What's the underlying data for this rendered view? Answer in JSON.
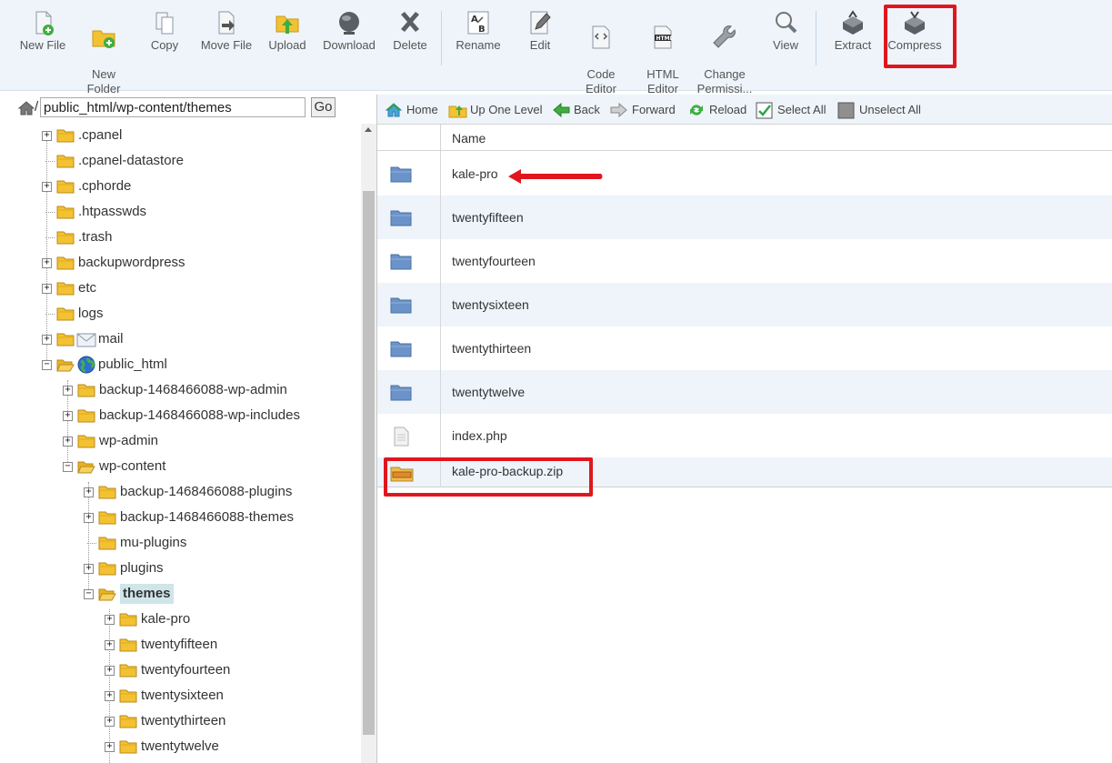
{
  "toolbar": {
    "buttons": [
      {
        "id": "new-file",
        "label": "New File"
      },
      {
        "id": "new-folder",
        "label": "New\nFolder"
      },
      {
        "id": "copy",
        "label": "Copy"
      },
      {
        "id": "move-file",
        "label": "Move File"
      },
      {
        "id": "upload",
        "label": "Upload"
      },
      {
        "id": "download",
        "label": "Download"
      },
      {
        "id": "delete",
        "label": "Delete"
      },
      {
        "id": "rename",
        "label": "Rename"
      },
      {
        "id": "edit",
        "label": "Edit"
      },
      {
        "id": "code-editor",
        "label": "Code\nEditor"
      },
      {
        "id": "html-editor",
        "label": "HTML\nEditor"
      },
      {
        "id": "change-permissions",
        "label": "Change\nPermissi..."
      },
      {
        "id": "view",
        "label": "View"
      },
      {
        "id": "extract",
        "label": "Extract"
      },
      {
        "id": "compress",
        "label": "Compress"
      }
    ],
    "html_icon_text": "HTML",
    "rename_icon_a": "A",
    "rename_icon_b": "B"
  },
  "path": {
    "root_sep": "/",
    "value": "public_html/wp-content/themes",
    "go_label": "Go"
  },
  "tree": [
    {
      "label": ".cpanel",
      "depth": 0,
      "expandable": true
    },
    {
      "label": ".cpanel-datastore",
      "depth": 0,
      "expandable": false
    },
    {
      "label": ".cphorde",
      "depth": 0,
      "expandable": true
    },
    {
      "label": ".htpasswds",
      "depth": 0,
      "expandable": false
    },
    {
      "label": ".trash",
      "depth": 0,
      "expandable": false
    },
    {
      "label": "backupwordpress",
      "depth": 0,
      "expandable": true
    },
    {
      "label": "etc",
      "depth": 0,
      "expandable": true
    },
    {
      "label": "logs",
      "depth": 0,
      "expandable": false
    },
    {
      "label": "mail",
      "depth": 0,
      "expandable": true,
      "icon": "mail"
    },
    {
      "label": "public_html",
      "depth": 0,
      "expandable": true,
      "expanded": true,
      "icon": "globe"
    },
    {
      "label": "backup-1468466088-wp-admin",
      "depth": 1,
      "expandable": true
    },
    {
      "label": "backup-1468466088-wp-includes",
      "depth": 1,
      "expandable": true
    },
    {
      "label": "wp-admin",
      "depth": 1,
      "expandable": true
    },
    {
      "label": "wp-content",
      "depth": 1,
      "expandable": true,
      "expanded": true
    },
    {
      "label": "backup-1468466088-plugins",
      "depth": 2,
      "expandable": true
    },
    {
      "label": "backup-1468466088-themes",
      "depth": 2,
      "expandable": true
    },
    {
      "label": "mu-plugins",
      "depth": 2,
      "expandable": false
    },
    {
      "label": "plugins",
      "depth": 2,
      "expandable": true
    },
    {
      "label": "themes",
      "depth": 2,
      "expandable": true,
      "expanded": true,
      "selected": true
    },
    {
      "label": "kale-pro",
      "depth": 3,
      "expandable": true
    },
    {
      "label": "twentyfifteen",
      "depth": 3,
      "expandable": true
    },
    {
      "label": "twentyfourteen",
      "depth": 3,
      "expandable": true
    },
    {
      "label": "twentysixteen",
      "depth": 3,
      "expandable": true
    },
    {
      "label": "twentythirteen",
      "depth": 3,
      "expandable": true
    },
    {
      "label": "twentytwelve",
      "depth": 3,
      "expandable": true
    }
  ],
  "nav": [
    {
      "id": "home",
      "label": "Home"
    },
    {
      "id": "up-one-level",
      "label": "Up One Level"
    },
    {
      "id": "back",
      "label": "Back"
    },
    {
      "id": "forward",
      "label": "Forward"
    },
    {
      "id": "reload",
      "label": "Reload"
    },
    {
      "id": "select-all",
      "label": "Select All"
    },
    {
      "id": "unselect-all",
      "label": "Unselect All"
    }
  ],
  "table": {
    "header_name": "Name",
    "rows": [
      {
        "name": "kale-pro",
        "type": "folder"
      },
      {
        "name": "twentyfifteen",
        "type": "folder"
      },
      {
        "name": "twentyfourteen",
        "type": "folder"
      },
      {
        "name": "twentysixteen",
        "type": "folder"
      },
      {
        "name": "twentythirteen",
        "type": "folder"
      },
      {
        "name": "twentytwelve",
        "type": "folder"
      },
      {
        "name": "index.php",
        "type": "file"
      },
      {
        "name": "kale-pro-backup.zip",
        "type": "archive"
      }
    ]
  },
  "colors": {
    "highlight": "#e0161e",
    "toolbar_bg": "#eef4fa",
    "selected_bg": "#cfe5ea",
    "folder_blue": "#6b93c9",
    "folder_yellow": "#f3c233"
  }
}
